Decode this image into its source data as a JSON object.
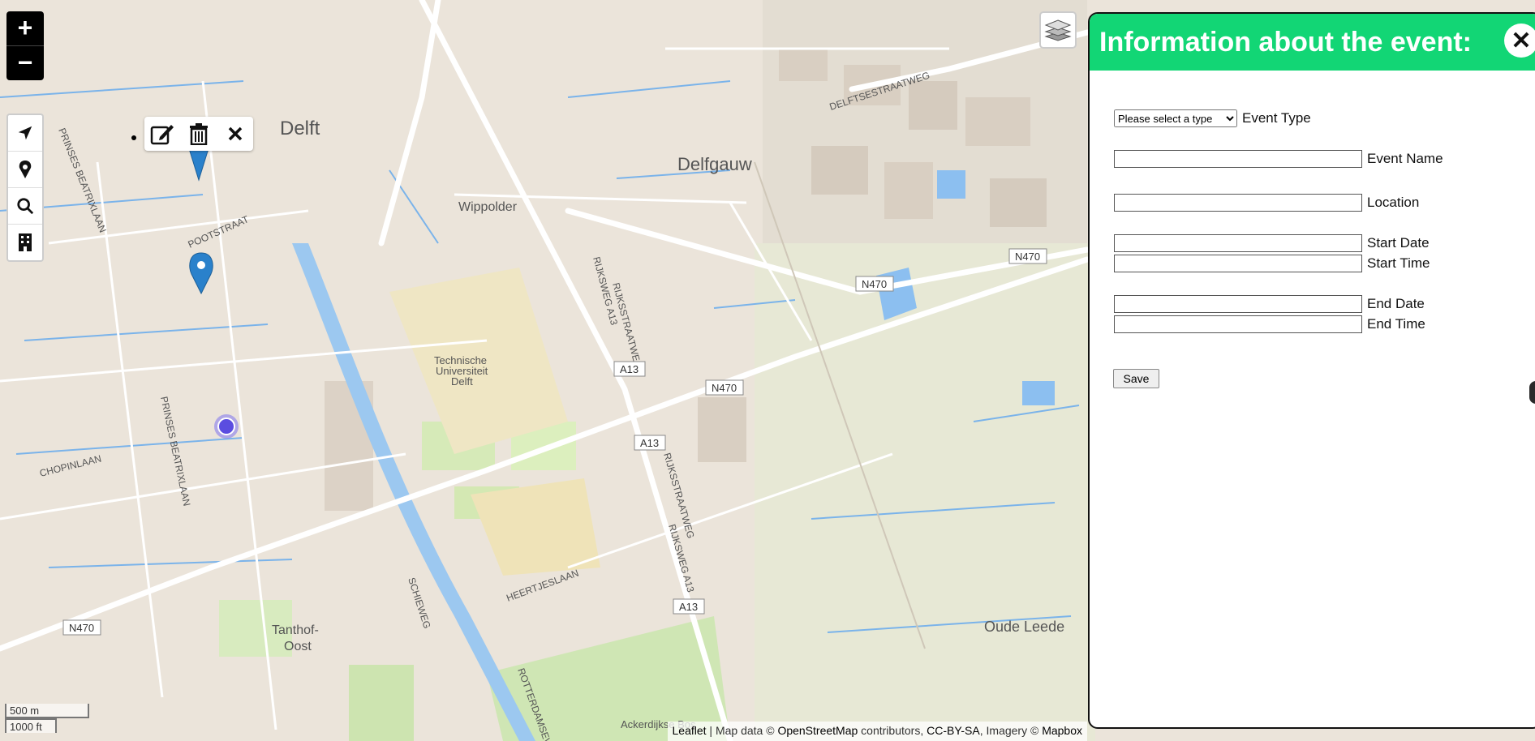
{
  "map": {
    "place_labels": {
      "delft": "Delft",
      "delfgauw": "Delfgauw",
      "wippolder": "Wippolder",
      "tu_line1": "Technische",
      "tu_line2": "Universiteit",
      "tu_line3": "Delft",
      "tanthof_line1": "Tanthof-",
      "tanthof_line2": "Oost",
      "oude_leede": "Oude Leede",
      "ackerdijkse": "Ackerdijkse Bos"
    },
    "street_labels": {
      "prinses_beatrixlaan_north": "PRINSES BEATRIXLAAN",
      "prinses_beatrixlaan_south": "PRINSES BEATRIXLAAN",
      "pootstraat": "POOTSTRAAT",
      "chopinlaan": "CHOPINLAAN",
      "delftsestraatweg": "DELFTSESTRAATWEG",
      "rijksweg_a13_1": "RIJKSWEG A13",
      "rijksstraatweg_1": "RIJKSSTRAATWEG",
      "rijksstraatweg_2": "RIJKSSTRAATWEG",
      "rijksweg_a13_2": "RIJKSWEG A13",
      "schieweg": "SCHIEWEG",
      "heertjeslaan": "HEERTJESLAAN",
      "rotterdamseweg": "ROTTERDAMSEW"
    },
    "road_shields": {
      "n470_a": "N470",
      "n470_b": "N470",
      "n470_c": "N470",
      "n470_d": "N470",
      "a13_a": "A13",
      "a13_b": "A13",
      "a13_c": "A13"
    },
    "markers": [
      {
        "name": "marker-1",
        "color": "#2a81cb"
      },
      {
        "name": "marker-2",
        "color": "#2a81cb"
      }
    ],
    "location_dot_color": "#5b4de0"
  },
  "controls": {
    "zoom_in": "+",
    "zoom_out": "−",
    "tool_icons": [
      "navigation-arrow-icon",
      "map-pin-icon",
      "search-icon",
      "building-icon"
    ],
    "popup_icons": [
      "edit-icon",
      "trash-icon",
      "close-icon"
    ],
    "layers_icon": "layers-icon"
  },
  "scale": {
    "metric": "500 m",
    "imperial": "1000 ft"
  },
  "attribution": {
    "leaflet": "Leaflet",
    "sep": " | ",
    "map_data": "Map data © ",
    "osm": "OpenStreetMap",
    "contributors": " contributors, ",
    "license": "CC-BY-SA",
    "imagery": ", Imagery © ",
    "mapbox": "Mapbox"
  },
  "panel": {
    "title": "Information about the event:",
    "close_glyph": "✕",
    "header_color": "#12d675",
    "type_select": {
      "selected": "Please select a type",
      "label": "Event Type"
    },
    "fields": {
      "event_name": "Event Name",
      "location": "Location",
      "start_date": "Start Date",
      "start_time": "Start Time",
      "end_date": "End Date",
      "end_time": "End Time"
    },
    "save_label": "Save"
  }
}
